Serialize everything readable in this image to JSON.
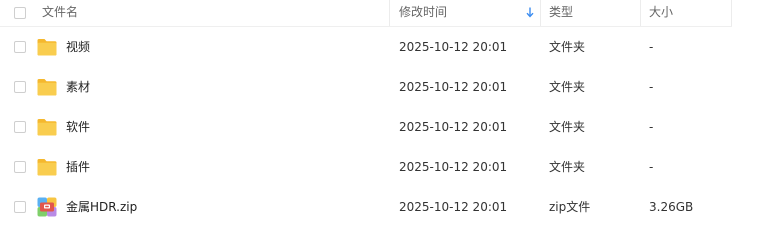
{
  "header": {
    "name": "文件名",
    "modified": "修改时间",
    "type": "类型",
    "size": "大小"
  },
  "files": [
    {
      "name": "视频",
      "modified": "2025-10-12 20:01",
      "type": "文件夹",
      "size": "-",
      "icon": "folder-icon"
    },
    {
      "name": "素材",
      "modified": "2025-10-12 20:01",
      "type": "文件夹",
      "size": "-",
      "icon": "folder-icon"
    },
    {
      "name": "软件",
      "modified": "2025-10-12 20:01",
      "type": "文件夹",
      "size": "-",
      "icon": "folder-icon"
    },
    {
      "name": "插件",
      "modified": "2025-10-12 20:01",
      "type": "文件夹",
      "size": "-",
      "icon": "folder-icon"
    },
    {
      "name": "金属HDR.zip",
      "modified": "2025-10-12 20:01",
      "type": "zip文件",
      "size": "3.26GB",
      "icon": "zip-archive-icon"
    }
  ],
  "colors": {
    "folder": "#f7c542",
    "sort_arrow": "#3b8cf0"
  }
}
